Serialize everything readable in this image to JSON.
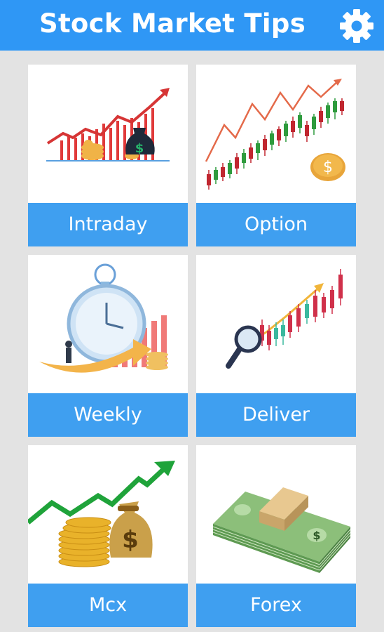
{
  "app": {
    "title": "Stock Market Tips"
  },
  "header": {
    "settings_icon": "gear-icon"
  },
  "colors": {
    "appbar": "#2f97f5",
    "label_bg": "#3f9ff0",
    "background": "#e3e3e3"
  },
  "categories": [
    {
      "label": "Intraday",
      "icon": "intraday-chart-icon"
    },
    {
      "label": "Option",
      "icon": "option-candlestick-icon"
    },
    {
      "label": "Weekly",
      "icon": "weekly-stopwatch-icon"
    },
    {
      "label": "Deliver",
      "icon": "deliver-magnifier-icon"
    },
    {
      "label": "Mcx",
      "icon": "mcx-coins-icon"
    },
    {
      "label": "Forex",
      "icon": "forex-cash-icon"
    }
  ]
}
